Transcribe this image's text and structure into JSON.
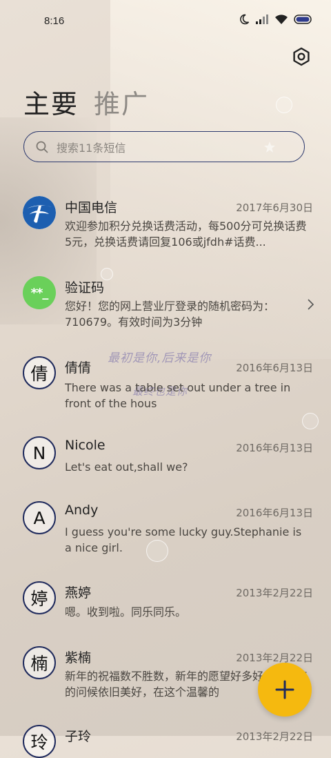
{
  "status_bar": {
    "time": "8:16",
    "icons": [
      "moon-icon",
      "signal-icon",
      "wifi-icon",
      "battery-icon"
    ]
  },
  "header": {
    "tabs": [
      {
        "label": "主要",
        "active": true
      },
      {
        "label": "推广",
        "active": false
      }
    ],
    "settings_icon": "gear-icon"
  },
  "search": {
    "placeholder": "搜索11条短信"
  },
  "messages": [
    {
      "avatar_type": "telecom-logo",
      "avatar_text": "",
      "name": "中国电信",
      "date": "2017年6月30日",
      "preview": "欢迎参加积分兑换话费活动，每500分可兑换话费5元，兑换话费请回复106或jfdh#话费..."
    },
    {
      "avatar_type": "green",
      "avatar_text": "**_",
      "name": "验证码",
      "date": "",
      "preview": "您好！您的网上营业厅登录的随机密码为：710679。有效时间为3分钟"
    },
    {
      "avatar_type": "ring",
      "avatar_text": "倩",
      "name": "倩倩",
      "date": "2016年6月13日",
      "preview": "There was a table set out under a tree in front of the hous"
    },
    {
      "avatar_type": "ring",
      "avatar_text": "N",
      "name": "Nicole",
      "date": "2016年6月13日",
      "preview": "Let's eat out,shall we?"
    },
    {
      "avatar_type": "ring",
      "avatar_text": "A",
      "name": "Andy",
      "date": "2016年6月13日",
      "preview": "I guess you're some lucky guy.Stephanie is a nice girl."
    },
    {
      "avatar_type": "ring",
      "avatar_text": "婷",
      "name": "燕婷",
      "date": "2013年2月22日",
      "preview": "嗯。收到啦。同乐同乐。"
    },
    {
      "avatar_type": "ring",
      "avatar_text": "楠",
      "name": "紫楠",
      "date": "2013年2月22日",
      "preview": "新年的祝福数不胜数，新年的愿望好多好多，新年的问候依旧美好，在这个温馨的"
    },
    {
      "avatar_type": "ring",
      "avatar_text": "玲",
      "name": "子玲",
      "date": "2013年2月22日",
      "preview": ""
    }
  ],
  "wallpaper_text": {
    "line1": "最初是你,后来是你",
    "line2": "最终也是你"
  },
  "fab": {
    "icon": "plus-icon",
    "color": "#f5b90f"
  },
  "colors": {
    "accent": "#1f2a5c",
    "fab": "#f5b90f",
    "green_avatar": "#6ad05a"
  }
}
